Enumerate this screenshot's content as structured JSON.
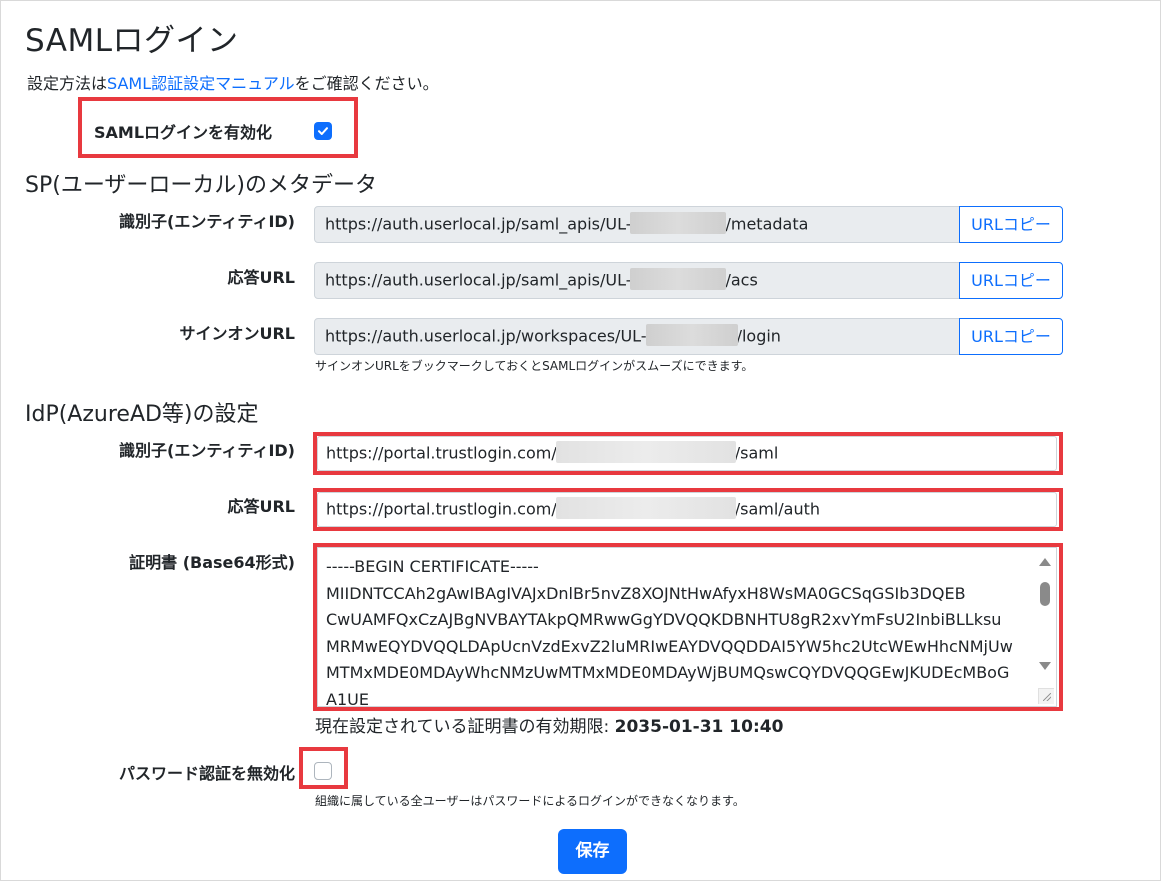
{
  "page": {
    "title": "SAMLログイン",
    "intro_prefix": "設定方法は",
    "intro_link": "SAML認証設定マニュアル",
    "intro_suffix": "をご確認ください。"
  },
  "enable_saml": {
    "label": "SAMLログインを有効化",
    "checked": true
  },
  "sp_section": {
    "title": "SP(ユーザーローカル)のメタデータ",
    "copy_label": "URLコピー",
    "fields": [
      {
        "label": "識別子(エンティティID)",
        "value_prefix": "https://auth.userlocal.jp/saml_apis/UL-",
        "value_suffix": "/metadata"
      },
      {
        "label": "応答URL",
        "value_prefix": "https://auth.userlocal.jp/saml_apis/UL-",
        "value_suffix": "/acs"
      },
      {
        "label": "サインオンURL",
        "value_prefix": "https://auth.userlocal.jp/workspaces/UL-",
        "value_suffix": "/login"
      }
    ],
    "signon_help": "サインオンURLをブックマークしておくとSAMLログインがスムーズにできます。"
  },
  "idp_section": {
    "title": "IdP(AzureAD等)の設定",
    "entity_id": {
      "label": "識別子(エンティティID)",
      "value_prefix": "https://portal.trustlogin.com/",
      "value_suffix": "/saml"
    },
    "reply_url": {
      "label": "応答URL",
      "value_prefix": "https://portal.trustlogin.com/",
      "value_suffix": "/saml/auth"
    },
    "certificate": {
      "label": "証明書 (Base64形式)",
      "lines": [
        "-----BEGIN CERTIFICATE-----",
        "MIIDNTCCAh2gAwIBAgIVAJxDnlBr5nvZ8XOJNtHwAfyxH8WsMA0GCSqGSIb3DQEB",
        "CwUAMFQxCzAJBgNVBAYTAkpQMRwwGgYDVQQKDBNHTU8gR2xvYmFsU2InbiBLLksu",
        "MRMwEQYDVQQLDApUcnVzdExvZ2luMRIwEAYDVQQDDAI5YW5hc2UtcWEwHhcNMjUw",
        "MTMxMDE0MDAyWhcNMzUwMTMxMDE0MDAyWjBUMQswCQYDVQQGEwJKUDEcMBoG",
        "A1UE"
      ],
      "expiry_label": "現在設定されている証明書の有効期限: ",
      "expiry_value": "2035-01-31 10:40"
    }
  },
  "disable_password": {
    "label": "パスワード認証を無効化",
    "checked": false,
    "help": "組織に属している全ユーザーはパスワードによるログインができなくなります。"
  },
  "save_label": "保存",
  "colors": {
    "accent": "#0d6efd",
    "highlight": "#e8393f",
    "readonly_bg": "#e9ecef"
  }
}
